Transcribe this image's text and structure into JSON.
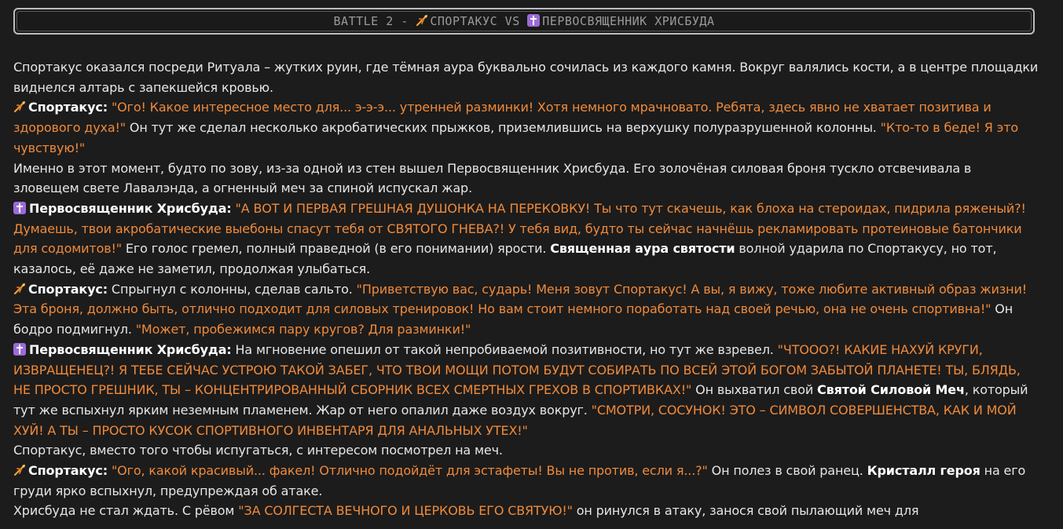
{
  "header": {
    "prefix": "BATTLE 2 - ",
    "fighter1": "СПОРТАКУС",
    "vs": " VS ",
    "fighter2": "ПЕРВОСВЯЩЕННИК ХРИСБУДА",
    "fighter1_icon": "running-athlete-icon",
    "fighter2_icon": "latin-cross-icon"
  },
  "story": {
    "p1": "Спортакус оказался посреди Ритуала – жутких руин, где тёмная аура буквально сочилась из каждого камня. Вокруг валялись кости, а в центре площадки виднелся алтарь с запекшейся кровью.",
    "p2": {
      "speaker": "Спортакус:",
      "quote1": "\"Ого! Какое интересное место для... э-э-э... утренней разминки! Хотя немного мрачновато. Ребята, здесь явно не хватает позитива и здорового духа!\"",
      "text1": " Он тут же сделал несколько акробатических прыжков, приземлившись на верхушку полуразрушенной колонны. ",
      "quote2": "\"Кто-то в беде! Я это чувствую!\""
    },
    "p3": "Именно в этот момент, будто по зову, из-за одной из стен вышел Первосвященник Хрисбуда. Его золочёная силовая броня тускло отсвечивала в зловещем свете Лавалэнда, а огненный меч за спиной испускал жар.",
    "p4": {
      "speaker": "Первосвященник Хрисбуда:",
      "quote1": "\"А ВОТ И ПЕРВАЯ ГРЕШНАЯ ДУШОНКА НА ПЕРЕКОВКУ! Ты что тут скачешь, как блоха на стероидах, пидрила ряженый?! Думаешь, твои акробатические выебоны спасут тебя от СВЯТОГО ГНЕВА?! У тебя вид, будто ты сейчас начнёшь рекламировать протеиновые батончики для содомитов!\"",
      "text1": " Его голос гремел, полный праведной (в его понимании) ярости. ",
      "bold1": "Священная аура святости",
      "text2": " волной ударила по Спортакусу, но тот, казалось, её даже не заметил, продолжая улыбаться."
    },
    "p5": {
      "speaker": "Спортакус:",
      "text1": " Спрыгнул с колонны, сделав сальто. ",
      "quote1": "\"Приветствую вас, сударь! Меня зовут Спортакус! А вы, я вижу, тоже любите активный образ жизни! Эта броня, должно быть, отлично подходит для силовых тренировок! Но вам стоит немного поработать над своей речью, она не очень спортивна!\"",
      "text2": " Он бодро подмигнул. ",
      "quote2": "\"Может, пробежимся пару кругов? Для разминки!\""
    },
    "p6": {
      "speaker": "Первосвященник Хрисбуда:",
      "text1": " На мгновение опешил от такой непробиваемой позитивности, но тут же взревел. ",
      "quote1": "\"ЧТООО?! КАКИЕ НАХУЙ КРУГИ, ИЗВРАЩЕНЕЦ?! Я ТЕБЕ СЕЙЧАС УСТРОЮ ТАКОЙ ЗАБЕГ, ЧТО ТВОИ МОЩИ ПОТОМ БУДУТ СОБИРАТЬ ПО ВСЕЙ ЭТОЙ БОГОМ ЗАБЫТОЙ ПЛАНЕТЕ! ТЫ, БЛЯДЬ, НЕ ПРОСТО ГРЕШНИК, ТЫ – КОНЦЕНТРИРОВАННЫЙ СБОРНИК ВСЕХ СМЕРТНЫХ ГРЕХОВ В СПОРТИВКАХ!\"",
      "text2": " Он выхватил свой ",
      "bold1": "Святой Силовой Меч",
      "text3": ", который тут же вспыхнул ярким неземным пламенем. Жар от него опалил даже воздух вокруг. ",
      "quote2": "\"СМОТРИ, СОСУНОК! ЭТО – СИМВОЛ СОВЕРШЕНСТВА, КАК И МОЙ ХУЙ! А ТЫ – ПРОСТО КУСОК СПОРТИВНОГО ИНВЕНТАРЯ ДЛЯ АНАЛЬНЫХ УТЕХ!\""
    },
    "p7": "Спортакус, вместо того чтобы испугаться, с интересом посмотрел на меч.",
    "p8": {
      "speaker": "Спортакус:",
      "quote1": "\"Ого, какой красивый... факел! Отлично подойдёт для эстафеты! Вы не против, если я...?\"",
      "text1": " Он полез в свой ранец. ",
      "bold1": "Кристалл героя",
      "text2": " на его груди ярко вспыхнул, предупреждая об атаке."
    },
    "p9": {
      "text1": "Хрисбуда не стал ждать. С рёвом ",
      "quote1": "\"ЗА СОЛГЕСТА ВЕЧНОГО И ЦЕРКОВЬ ЕГО СВЯТУЮ!\"",
      "text2": " он ринулся в атаку, занося свой пылающий меч для"
    }
  },
  "colors": {
    "background": "#1c1c1c",
    "text": "#e6e6e6",
    "quote": "#f08a3a",
    "speaker": "#ffffff",
    "title": "#9a9a9a",
    "cross_icon_bg": "#9b6bd6"
  }
}
